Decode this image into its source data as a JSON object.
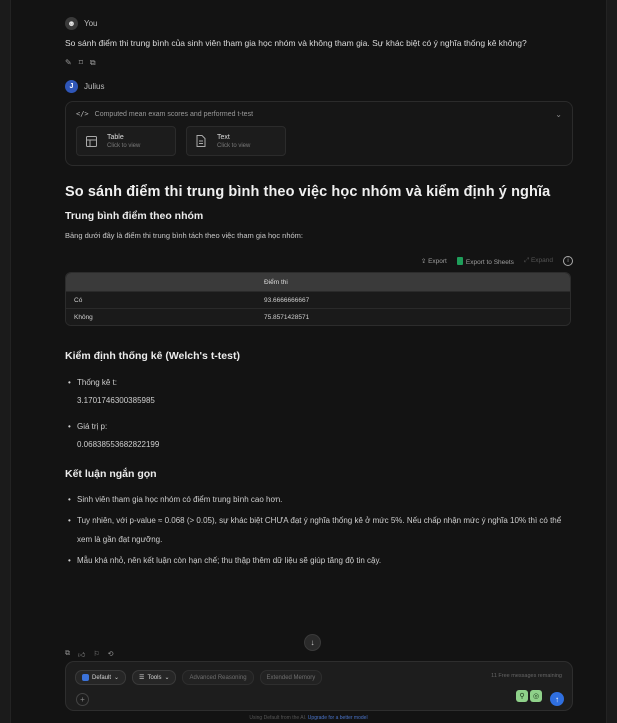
{
  "user": {
    "name": "You",
    "message": "So sánh điểm thi trung bình của sinh viên tham gia học nhóm và không tham gia. Sự khác biệt có ý nghĩa thống kê không?"
  },
  "assistant": {
    "name": "Julius",
    "tool_summary": "Computed mean exam scores and performed t-test",
    "outputs": [
      {
        "title": "Table",
        "subtitle": "Click to view",
        "icon": "table-icon"
      },
      {
        "title": "Text",
        "subtitle": "Click to view",
        "icon": "document-icon"
      }
    ]
  },
  "response": {
    "title": "So sánh điểm thi trung bình theo việc học nhóm và kiểm định ý nghĩa",
    "section1_heading": "Trung bình điểm theo nhóm",
    "section1_text": "Bảng dưới đây là điểm thi trung bình tách theo việc tham gia học nhóm:",
    "table_tools": {
      "export": "Export",
      "export_sheets": "Export to Sheets",
      "expand": "Expand"
    },
    "table": {
      "header": [
        "",
        "Điểm thi"
      ],
      "rows": [
        [
          "Có",
          "93.6666666667"
        ],
        [
          "Không",
          "75.8571428571"
        ]
      ]
    },
    "section2_heading": "Kiểm định thống kê (Welch's t-test)",
    "stats": [
      {
        "label": "Thống kê t:",
        "value": "3.1701746300385985"
      },
      {
        "label": "Giá trị p:",
        "value": "0.06838553682822199"
      }
    ],
    "section3_heading": "Kết luận ngắn gọn",
    "conclusions": [
      "Sinh viên tham gia học nhóm có điểm trung bình cao hơn.",
      "Tuy nhiên, với p-value ≈ 0.068 (> 0.05), sự khác biệt CHƯA đạt ý nghĩa thống kê ở mức 5%. Nếu chấp nhận mức ý nghĩa 10% thì có thể xem là gần đạt ngưỡng.",
      "Mẫu khá nhỏ, nên kết luận còn hạn chế; thu thập thêm dữ liệu sẽ giúp tăng độ tin cậy."
    ]
  },
  "composer": {
    "model_label": "Default",
    "tools_label": "Tools",
    "toggle1": "Advanced Reasoning",
    "toggle2": "Extended Memory",
    "free_messages": "11 Free messages remaining"
  },
  "footer": {
    "text": "Using Default from the AI.",
    "link": "Upgrade for a better model"
  },
  "colors": {
    "accent": "#2f6fe0",
    "background": "#131313",
    "sheets": "#1e9e5a"
  }
}
